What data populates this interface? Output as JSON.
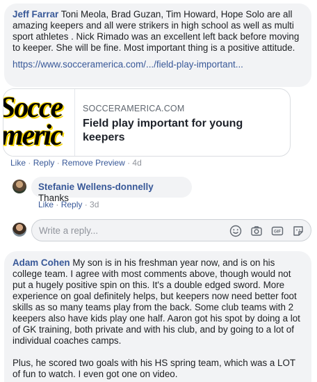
{
  "comment1": {
    "author": "Jeff Farrar",
    "text": " Toni Meola, Brad Guzan, Tim Howard, Hope Solo are all amazing keepers and all were strikers in high school as well as multi sport athletes . Nick Rimado was an excellent left back before moving to keeper. She will be fine. Most important thing is a positive attitude.",
    "link": "https://www.socceramerica.com/.../field-play-important..."
  },
  "preview": {
    "thumb_line1": "Socce",
    "thumb_line2": "meric",
    "domain": "SOCCERAMERICA.COM",
    "title": "Field play important for young keepers"
  },
  "actions1": {
    "like": "Like",
    "reply": "Reply",
    "remove_preview": "Remove Preview",
    "time": "4d",
    "sep": " · "
  },
  "comment2": {
    "author": "Stefanie Wellens-donnelly",
    "text": " Thanks"
  },
  "actions2": {
    "like": "Like",
    "reply": "Reply",
    "time": "3d",
    "sep": " · "
  },
  "composer": {
    "placeholder": "Write a reply...",
    "icons": [
      "emoji-icon",
      "camera-icon",
      "gif-icon",
      "sticker-icon"
    ],
    "gif_label": "GIF"
  },
  "comment3": {
    "author": "Adam Cohen",
    "para1": " My son is in his freshman year now, and is on his college team. I agree with most comments above, though would not put a hugely positive spin on this. It's a double edged sword. More experience on goal definitely helps, but keepers now need better foot skills as so many teams play from the back. Some club teams with 2 keepers also have kids play one half. Aaron got his spot by doing a lot of GK training, both private and with his club, and by going to a lot of individual coaches camps.",
    "para2": "Plus, he scored two goals with his HS spring team, which was a LOT of fun to watch. I even got one on video."
  },
  "colors": {
    "link": "#385898",
    "bubble": "#f2f3f5",
    "meta": "#90949c"
  }
}
